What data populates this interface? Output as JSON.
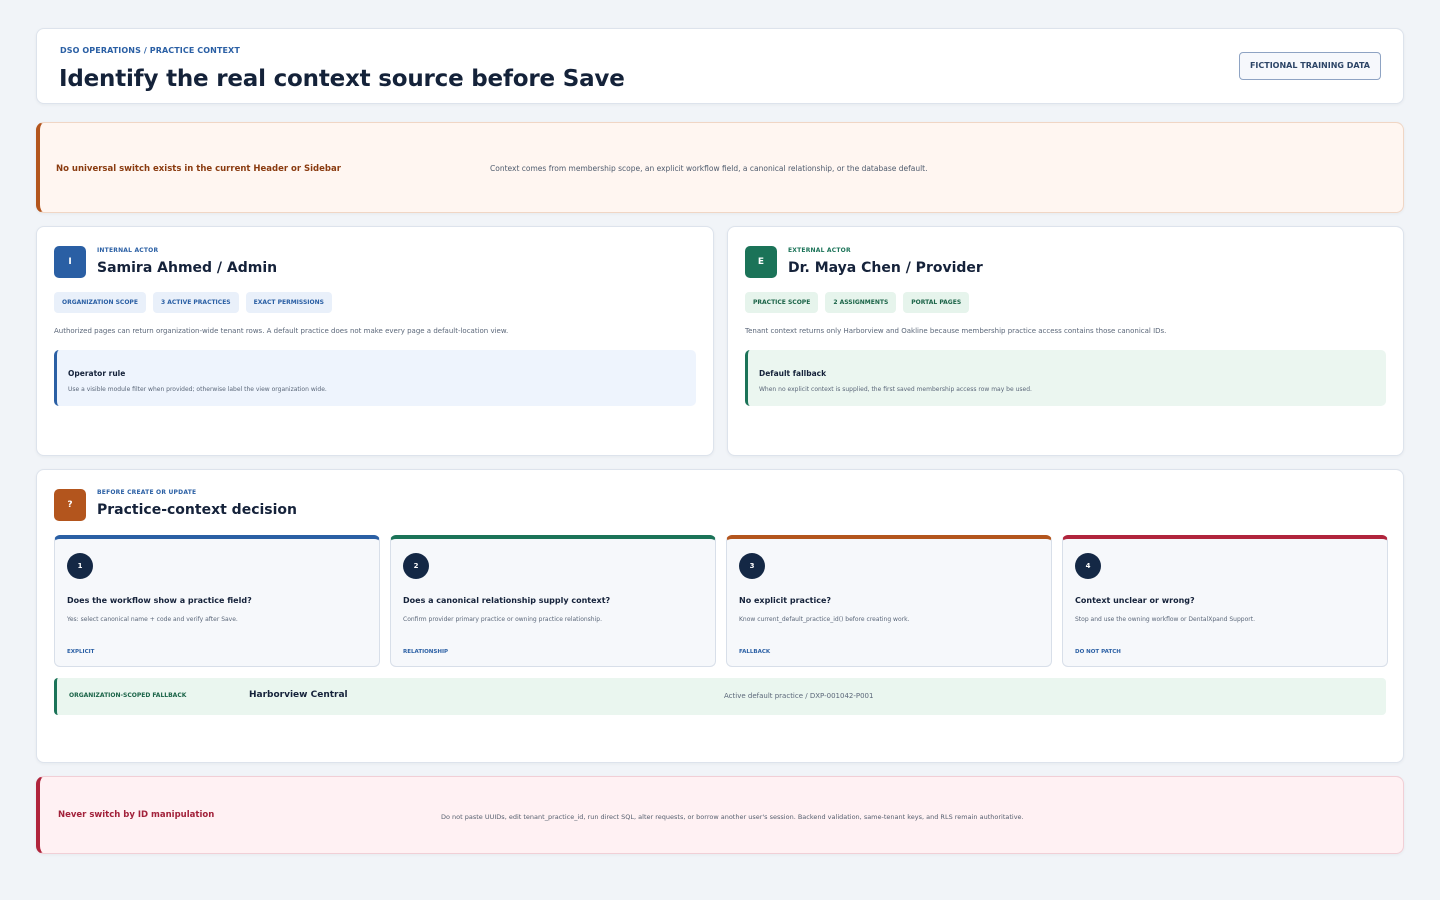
{
  "header": {
    "eyebrow": "DSO OPERATIONS / PRACTICE CONTEXT",
    "title": "Identify the real context source before Save",
    "badge": "FICTIONAL TRAINING DATA"
  },
  "warning": {
    "title": "No universal switch exists in the current Header or Sidebar",
    "text": "Context comes from membership scope, an explicit workflow field, a canonical relationship, or the database default."
  },
  "internal_actor": {
    "avatar": "I",
    "kicker": "INTERNAL ACTOR",
    "name": "Samira Ahmed / Admin",
    "chips": [
      "ORGANIZATION SCOPE",
      "3 ACTIVE PRACTICES",
      "EXACT PERMISSIONS"
    ],
    "text": "Authorized pages can return organization-wide tenant rows. A default practice does not make every page a default-location view.",
    "rule_title": "Operator rule",
    "rule_text": "Use a visible module filter when provided; otherwise label the view organization wide."
  },
  "external_actor": {
    "avatar": "E",
    "kicker": "EXTERNAL ACTOR",
    "name": "Dr. Maya Chen / Provider",
    "chips": [
      "PRACTICE SCOPE",
      "2 ASSIGNMENTS",
      "PORTAL PAGES"
    ],
    "text": "Tenant context returns only Harborview and Oakline because membership practice access contains those canonical IDs.",
    "rule_title": "Default fallback",
    "rule_text": "When no explicit context is supplied, the first saved membership access row may be used."
  },
  "decision": {
    "avatar": "?",
    "kicker": "BEFORE CREATE OR UPDATE",
    "title": "Practice-context decision",
    "steps": [
      {
        "num": "1",
        "question": "Does the workflow show a practice field?",
        "detail": "Yes: select canonical name + code and verify after Save.",
        "tag": "EXPLICIT",
        "color": "#2a5fa4"
      },
      {
        "num": "2",
        "question": "Does a canonical relationship supply context?",
        "detail": "Confirm provider primary practice or owning practice relationship.",
        "tag": "RELATIONSHIP",
        "color": "#1b7358"
      },
      {
        "num": "3",
        "question": "No explicit practice?",
        "detail": "Know current_default_practice_id() before creating work.",
        "tag": "FALLBACK",
        "color": "#b3551d"
      },
      {
        "num": "4",
        "question": "Context unclear or wrong?",
        "detail": "Stop and use the owning workflow or DentalXpand Support.",
        "tag": "DO NOT PATCH",
        "color": "#b0243c"
      }
    ],
    "fallback_label": "ORGANIZATION-SCOPED FALLBACK",
    "fallback_value": "Harborview Central",
    "fallback_meta": "Active default practice / DXP-001042-P001"
  },
  "danger": {
    "title": "Never switch by ID manipulation",
    "text": "Do not paste UUIDs, edit tenant_practice_id, run direct SQL, alter requests, or borrow another user's session. Backend validation, same-tenant keys, and RLS remain authoritative."
  }
}
